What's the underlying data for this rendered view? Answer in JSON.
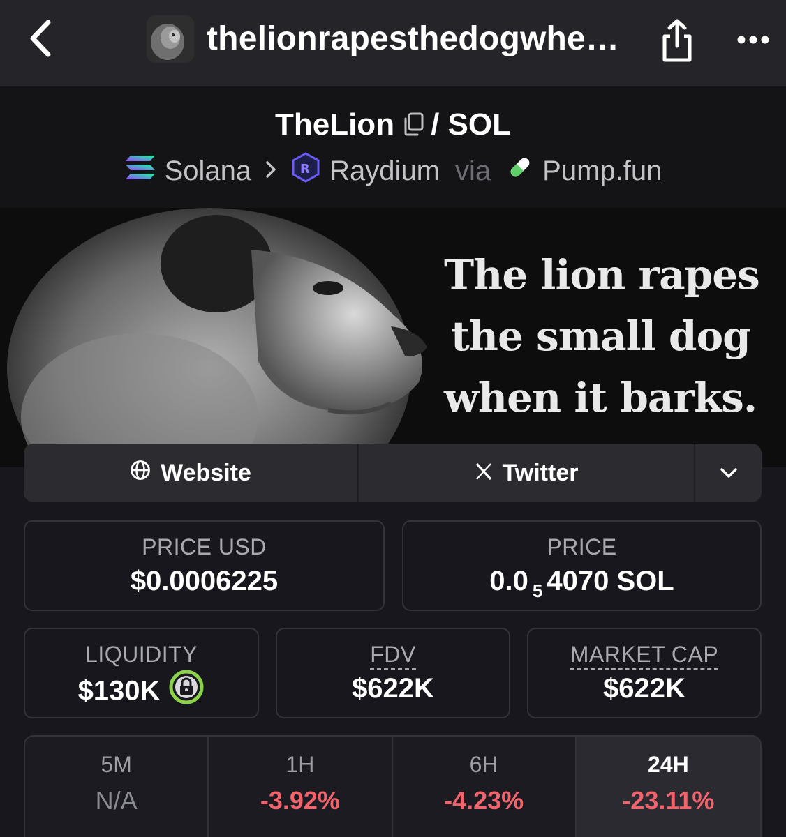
{
  "topbar": {
    "site_title": "thelionrapesthedogwhe…"
  },
  "pair": {
    "base": "TheLion",
    "separator": "/",
    "quote": "SOL",
    "chain": "Solana",
    "dex": "Raydium",
    "via_label": "via",
    "launchpad": "Pump.fun"
  },
  "banner": {
    "lines": [
      "The lion rapes",
      "the small dog",
      "when it barks."
    ]
  },
  "links": {
    "website": "Website",
    "twitter": "Twitter"
  },
  "stats": {
    "price_usd_label": "PRICE USD",
    "price_usd_value": "$0.0006225",
    "price_label": "PRICE",
    "price_prefix": "0.0",
    "price_subscript": "5",
    "price_suffix": "4070 SOL",
    "liquidity_label": "LIQUIDITY",
    "liquidity_value": "$130K",
    "fdv_label": "FDV",
    "fdv_value": "$622K",
    "mcap_label": "MARKET CAP",
    "mcap_value": "$622K"
  },
  "timeframes": [
    {
      "label": "5M",
      "value": "N/A"
    },
    {
      "label": "1H",
      "value": "-3.92%"
    },
    {
      "label": "6H",
      "value": "-4.23%"
    },
    {
      "label": "24H",
      "value": "-23.11%"
    }
  ],
  "colors": {
    "negative": "#f0646d",
    "lock_ring": "#8cd14a",
    "topbar_bg": "#242429",
    "page_bg": "#17171d"
  },
  "icons": {
    "back": "chevron-left-icon",
    "share": "share-icon",
    "more": "ellipsis-icon",
    "copy": "copy-icon",
    "solana": "solana-icon",
    "raydium": "raydium-icon",
    "pumpfun": "pill-icon",
    "website": "globe-icon",
    "twitter": "x-icon",
    "expand": "chevron-down-icon",
    "lock": "lock-icon"
  }
}
